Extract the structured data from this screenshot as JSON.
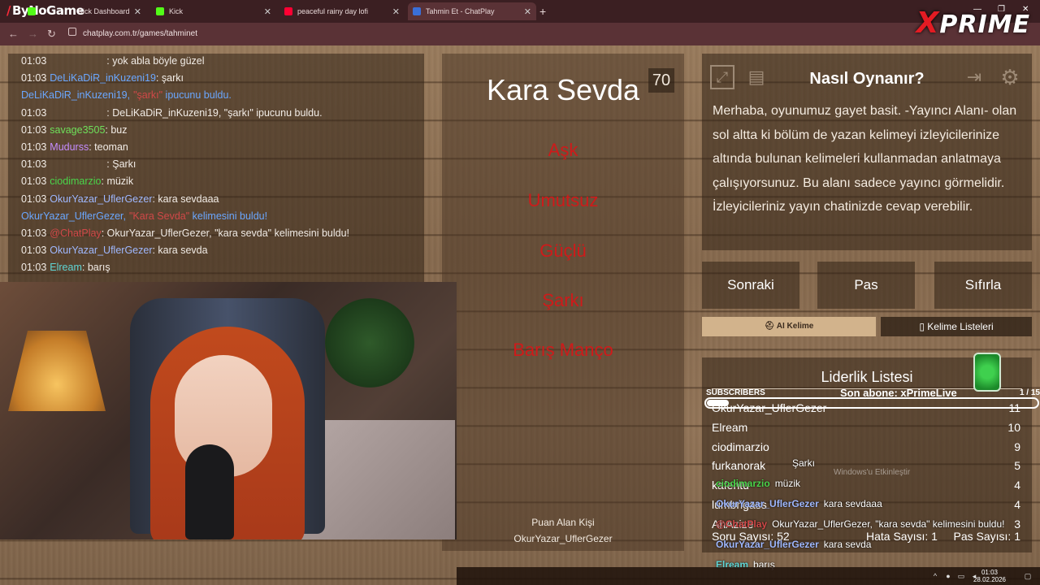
{
  "browser": {
    "brand": "ByNoGame",
    "tabs": [
      {
        "title": "Kick Dashboard",
        "color": "#53fc18"
      },
      {
        "title": "Kick",
        "color": "#53fc18"
      },
      {
        "title": "peaceful rainy day lofi",
        "color": "#ff0033"
      },
      {
        "title": "Tahmin Et - ChatPlay",
        "color": "#3a6fd8"
      }
    ],
    "url": "chatplay.com.tr/games/tahminet",
    "logo": {
      "x": "X",
      "rest": "PRIME"
    }
  },
  "chat": [
    {
      "time": "01:03",
      "user": "",
      "msg": ": yok abla böyle güzel",
      "color": "#d04848"
    },
    {
      "time": "01:03",
      "user": "DeLiKaDiR_inKuzeni19",
      "msg": ": şarkı",
      "color": "#6aa7ff"
    },
    {
      "time": "",
      "user": "DeLiKaDiR_inKuzeni19,",
      "msg": " ipucunu buldu.",
      "color": "#6aa7ff",
      "system": true,
      "quote": "\"şarkı\""
    },
    {
      "time": "01:03",
      "user": "",
      "msg": ": DeLiKaDiR_inKuzeni19, \"şarkı\" ipucunu buldu.",
      "color": "#d04848"
    },
    {
      "time": "01:03",
      "user": "savage3505",
      "msg": ": buz",
      "color": "#6ee05a"
    },
    {
      "time": "01:03",
      "user": "Mudurss",
      "msg": ": teoman",
      "color": "#c58cff"
    },
    {
      "time": "01:03",
      "user": "",
      "msg": ": Şarkı",
      "color": "#d04848"
    },
    {
      "time": "01:03",
      "user": "ciodimarzio",
      "msg": ": müzik",
      "color": "#4ad44a"
    },
    {
      "time": "01:03",
      "user": "OkurYazar_UflerGezer",
      "msg": ": kara sevdaaa",
      "color": "#9fb8ff"
    },
    {
      "time": "",
      "user": "OkurYazar_UflerGezer,",
      "msg": " kelimesini buldu!",
      "color": "#6aa7ff",
      "system": true,
      "quote": "\"Kara Sevda\""
    },
    {
      "time": "01:03",
      "user": "@ChatPlay",
      "msg": ": OkurYazar_UflerGezer, \"kara sevda\" kelimesini buldu!",
      "color": "#d04848"
    },
    {
      "time": "01:03",
      "user": "OkurYazar_UflerGezer",
      "msg": ": kara sevda",
      "color": "#9fb8ff"
    },
    {
      "time": "01:03",
      "user": "Elream",
      "msg": ": barış",
      "color": "#5fd6d6"
    }
  ],
  "game": {
    "score": "70",
    "word": "Kara Sevda",
    "forbidden": [
      "Aşk",
      "Umutsuz",
      "Güçlü",
      "Şarkı",
      "Barış Manço"
    ],
    "scorer_label": "Puan Alan Kişi",
    "scorer_name": "OkurYazar_UflerGezer"
  },
  "howto": {
    "title": "Nasıl Oynanır?",
    "text": "Merhaba, oyunumuz gayet basit. -Yayıncı Alanı- olan sol altta ki bölüm de yazan kelimeyi izleyicilerinize altında bulunan kelimeleri kullanmadan anlatmaya çalışıyorsunuz. Bu alanı sadece yayıncı görmelidir. İzleyicileriniz yayın chatinizde cevap verebilir."
  },
  "actions": {
    "next": "Sonraki",
    "pass": "Pas",
    "reset": "Sıfırla",
    "ai_word": "AI Kelime",
    "word_lists": "Kelime Listeleri"
  },
  "leaderboard": {
    "title": "Liderlik Listesi",
    "rows": [
      {
        "name": "OkurYazar_UflerGezer",
        "points": "11"
      },
      {
        "name": "Elream",
        "points": "10"
      },
      {
        "name": "ciodimarzio",
        "points": "9"
      },
      {
        "name": "furkanorak",
        "points": "5"
      },
      {
        "name": "kafentu",
        "points": "4"
      },
      {
        "name": "lumbrigass",
        "points": "4"
      },
      {
        "name": "AhAzize",
        "points": "3"
      }
    ],
    "footer": {
      "questions": "Soru Sayısı: 52",
      "errors": "Hata Sayısı: 1",
      "passes": "Pas Sayısı: 1"
    }
  },
  "overlay": {
    "subs_label": "SUBSCRIBERS",
    "latest_sub": "Son abone: xPrimeLive",
    "subs_count": "1 / 15",
    "subs_progress": 0.067,
    "chat": [
      {
        "user": "",
        "msg": "Şarkı",
        "color": "#d04848"
      },
      {
        "user": "ciodimarzio",
        "msg": "müzik",
        "color": "#4ad44a"
      },
      {
        "user": "OkurYazar_UflerGezer",
        "msg": "kara sevdaaa",
        "color": "#9fb8ff"
      },
      {
        "user": "@ChatPlay",
        "msg": "OkurYazar_UflerGezer, \"kara sevda\" kelimesini buldu!",
        "color": "#d04848"
      },
      {
        "user": "OkurYazar_UflerGezer",
        "msg": "kara sevda",
        "color": "#9fb8ff"
      },
      {
        "user": "Elream",
        "msg": "barış",
        "color": "#5fd6d6"
      }
    ],
    "windows_notice": "Windows'u Etkinleştir"
  },
  "taskbar": {
    "time": "01:03",
    "date": "28.02.2026"
  }
}
